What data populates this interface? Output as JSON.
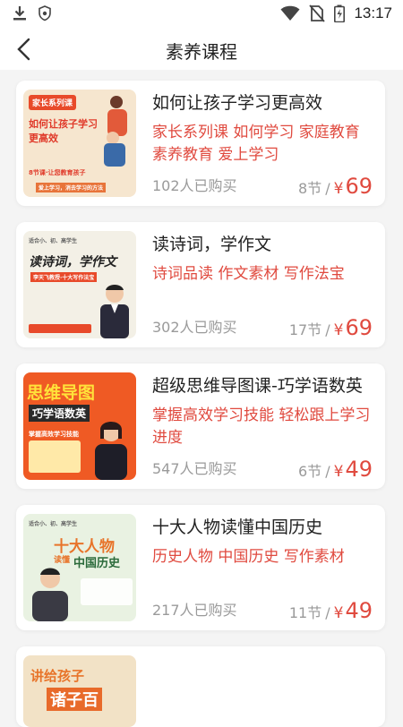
{
  "status": {
    "time": "13:17"
  },
  "header": {
    "title": "素养课程"
  },
  "courses": [
    {
      "title": "如何让孩子学习更高效",
      "tags": "家长系列课 如何学习 家庭教育 素养教育 爱上学习",
      "buyers": "102人已购买",
      "lessons": "8节",
      "slash": "/",
      "yen": "¥",
      "price": "69",
      "thumb_lines": [
        "家长系列课",
        "如何让孩子学习",
        "更高效",
        "8节课·让您教育孩子",
        "爱上学习，消去学习的方法"
      ]
    },
    {
      "title": "读诗词，学作文",
      "tags": "诗词品读 作文素材 写作法宝",
      "buyers": "302人已购买",
      "lessons": "17节",
      "slash": "/",
      "yen": "¥",
      "price": "69",
      "thumb_lines": [
        "适合小、初、高学生",
        "读诗词，学作文",
        "李天飞教授·十大写作法宝"
      ]
    },
    {
      "title": "超级思维导图课-巧学语数英",
      "tags": "掌握高效学习技能 轻松跟上学习进度",
      "buyers": "547人已购买",
      "lessons": "6节",
      "slash": "/",
      "yen": "¥",
      "price": "49",
      "thumb_lines": [
        "思维导图",
        "巧学语数英",
        "掌握高效学习技能"
      ]
    },
    {
      "title": "十大人物读懂中国历史",
      "tags": "历史人物 中国历史 写作素材",
      "buyers": "217人已购买",
      "lessons": "11节",
      "slash": "/",
      "yen": "¥",
      "price": "49",
      "thumb_lines": [
        "适合小、初、高学生",
        "十大人物",
        "读懂",
        "中国历史"
      ]
    },
    {
      "title": "",
      "tags": "",
      "buyers": "",
      "lessons": "",
      "slash": "",
      "yen": "",
      "price": "",
      "thumb_lines": [
        "讲给孩子",
        "诸子百"
      ]
    }
  ],
  "colors": {
    "accent": "#e04a3f",
    "muted": "#9a9a9a"
  },
  "icons": [
    "download-icon",
    "shield-icon",
    "wifi-icon",
    "no-sim-icon",
    "battery-icon",
    "back-arrow-icon"
  ]
}
